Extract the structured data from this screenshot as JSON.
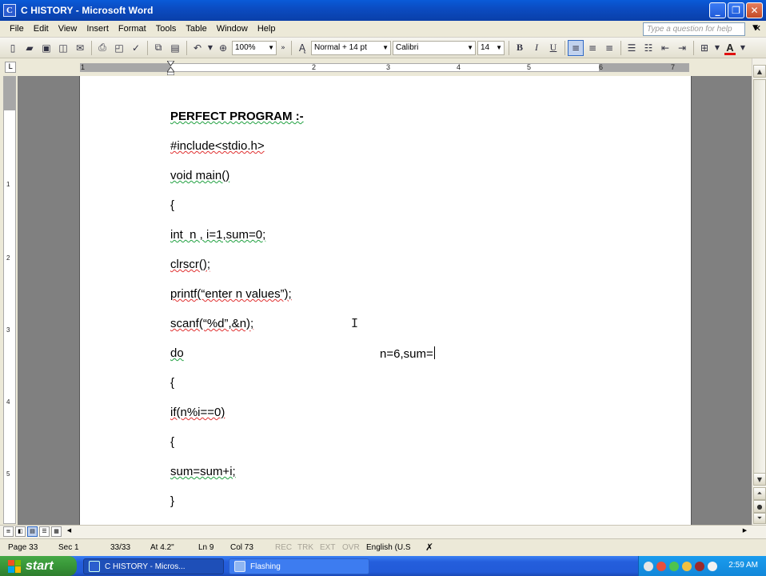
{
  "window": {
    "icon_letter": "C",
    "title": "C  HISTORY - Microsoft Word",
    "btn_min": "_",
    "btn_max": "❐",
    "btn_close": "✕"
  },
  "menu": {
    "items": [
      "File",
      "Edit",
      "View",
      "Insert",
      "Format",
      "Tools",
      "Table",
      "Window",
      "Help"
    ],
    "ask_placeholder": "Type a question for help",
    "close_doc": "✕"
  },
  "toolbar": {
    "zoom": "100%",
    "style": "Normal + 14 pt",
    "font": "Calibri",
    "size": "14",
    "bold": "B",
    "italic": "I",
    "underline": "U",
    "font_color_label": "A"
  },
  "ruler": {
    "tab_selector": "L",
    "numbers": [
      "1",
      "2",
      "3",
      "4",
      "5",
      "6",
      "7"
    ],
    "vertical_numbers": [
      "1",
      "2",
      "3",
      "4",
      "5"
    ]
  },
  "document": {
    "lines": [
      "PERFECT PROGRAM :-",
      "#include<stdio.h>",
      "void main()",
      "{",
      "int  n , i=1,sum=0;",
      "clrscr();",
      "printf(“enter n values”);",
      "scanf(“%d”,&n);",
      "do",
      "{",
      "if(n%i==0)",
      "{",
      "sum=sum+i;",
      "}"
    ],
    "side_note": "n=6,sum=",
    "cursor_glyph": "I"
  },
  "statusbar": {
    "page": "Page 33",
    "sec": "Sec 1",
    "pages": "33/33",
    "at": "At 4.2\"",
    "ln": "Ln 9",
    "col": "Col 73",
    "rec": "REC",
    "trk": "TRK",
    "ext": "EXT",
    "ovr": "OVR",
    "language": "English (U.S"
  },
  "taskbar": {
    "start": "start",
    "items": [
      "C  HISTORY - Micros...",
      "Flashing"
    ],
    "clock": "2:59 AM"
  },
  "colors": {
    "titlebar": "#0a5bd8",
    "taskbar": "#245edc",
    "start": "#3a9a3a",
    "spell_red": "#e03030",
    "grammar_green": "#20a040"
  }
}
